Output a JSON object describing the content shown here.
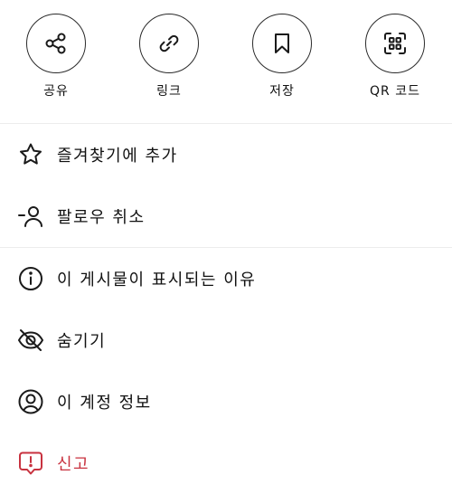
{
  "actions": [
    {
      "label": "공유",
      "icon": "share-icon"
    },
    {
      "label": "링크",
      "icon": "link-icon"
    },
    {
      "label": "저장",
      "icon": "bookmark-icon"
    },
    {
      "label": "QR 코드",
      "icon": "qr-code-icon"
    }
  ],
  "menu": {
    "favorite": "즐겨찾기에 추가",
    "unfollow": "팔로우 취소",
    "why_shown": "이 게시물이 표시되는 이유",
    "hide": "숨기기",
    "about_account": "이 계정 정보",
    "report": "신고"
  },
  "colors": {
    "danger": "#c8323f",
    "icon": "#1a1a1a",
    "divider": "#ececec"
  }
}
